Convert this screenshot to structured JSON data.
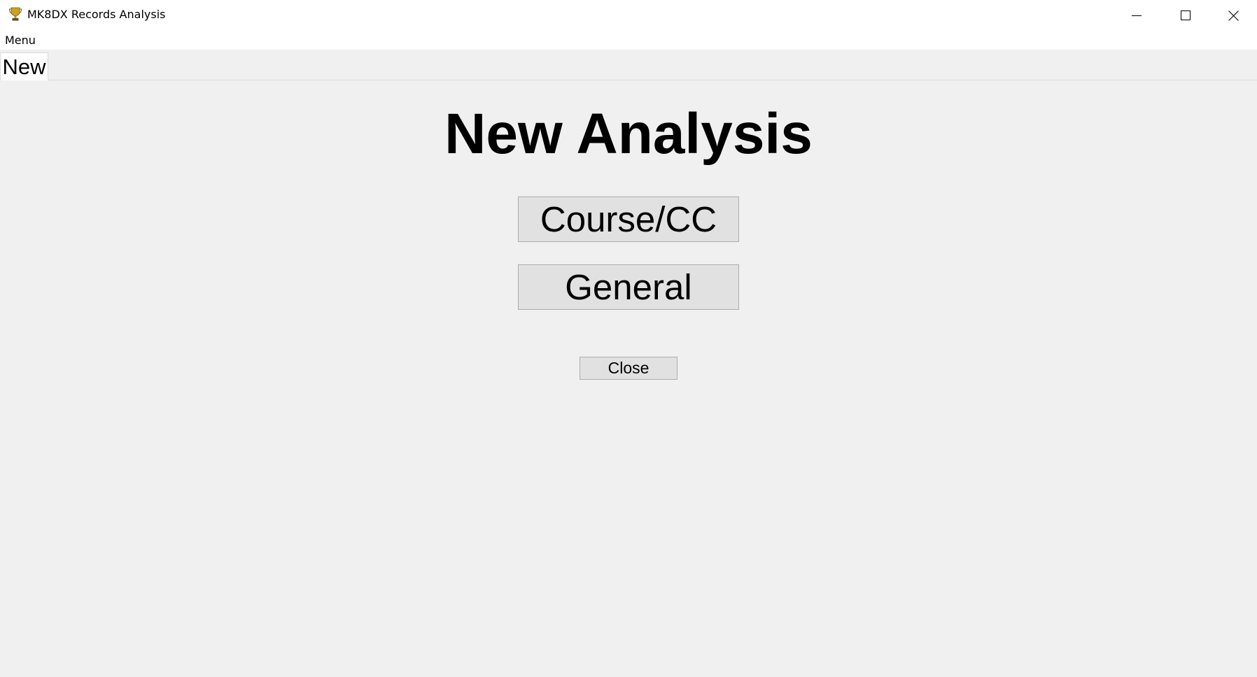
{
  "window": {
    "title": "MK8DX Records Analysis",
    "icon": "trophy-icon"
  },
  "menubar": {
    "items": [
      {
        "label": "Menu"
      }
    ]
  },
  "tabs": [
    {
      "label": "New",
      "selected": true
    }
  ],
  "main": {
    "heading": "New Analysis",
    "buttons": [
      {
        "label": "Course/CC"
      },
      {
        "label": "General"
      }
    ],
    "close_label": "Close"
  },
  "colors": {
    "background": "#f0f0f0",
    "button_face": "#e1e1e1",
    "button_border": "#adadad",
    "trophy": "#c9a227"
  }
}
